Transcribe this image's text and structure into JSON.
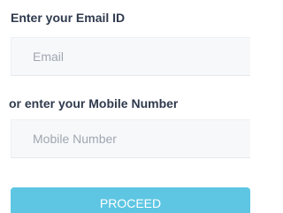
{
  "form": {
    "email_label": "Enter your Email ID",
    "email_placeholder": "Email",
    "email_value": "",
    "mobile_label": "or enter your Mobile Number",
    "mobile_placeholder": "Mobile Number",
    "mobile_value": "",
    "proceed_label": "PROCEED"
  },
  "colors": {
    "label_text": "#2f3a4d",
    "field_background": "#f7f8fa",
    "placeholder_text": "#a0a7b1",
    "proceed_button": "#5ec6e3",
    "proceed_text": "#ffffff"
  }
}
